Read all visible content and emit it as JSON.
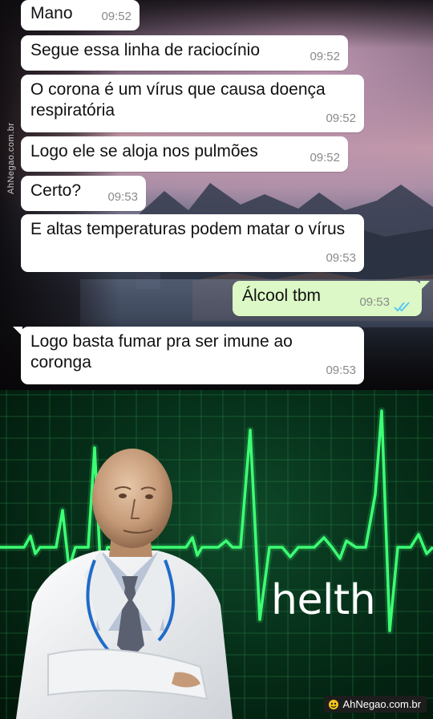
{
  "chat": {
    "watermark": "AhNegao.com.br",
    "messages": [
      {
        "direction": "in",
        "text": "Mano",
        "time": "09:52"
      },
      {
        "direction": "in",
        "text": "Segue essa linha de raciocínio",
        "time": "09:52"
      },
      {
        "direction": "in",
        "text": "O corona é um vírus que causa doença respiratória",
        "time": "09:52"
      },
      {
        "direction": "in",
        "text": "Logo ele se aloja nos pulmões",
        "time": "09:52"
      },
      {
        "direction": "in",
        "text": "Certo?",
        "time": "09:53"
      },
      {
        "direction": "in",
        "text": "E altas temperaturas podem matar o vírus",
        "time": "09:53"
      },
      {
        "direction": "out",
        "text": "Álcool tbm",
        "time": "09:53",
        "status_icon": "double-check-read-icon",
        "status_color": "#4fc3f7"
      },
      {
        "direction": "in",
        "text": "Logo basta fumar pra ser imune ao coronga",
        "time": "09:53"
      }
    ],
    "colors": {
      "incoming": "#ffffff",
      "outgoing": "#dcf8c6",
      "timestamp": "#8a8a8a"
    }
  },
  "meme": {
    "caption": "helth",
    "brand": "AhNegao.com.br",
    "brand_icon": "ahnegao-logo-icon",
    "colors": {
      "ecg_line": "#3cff74",
      "grid": "#2a8a4a",
      "background": "#06301a"
    }
  }
}
